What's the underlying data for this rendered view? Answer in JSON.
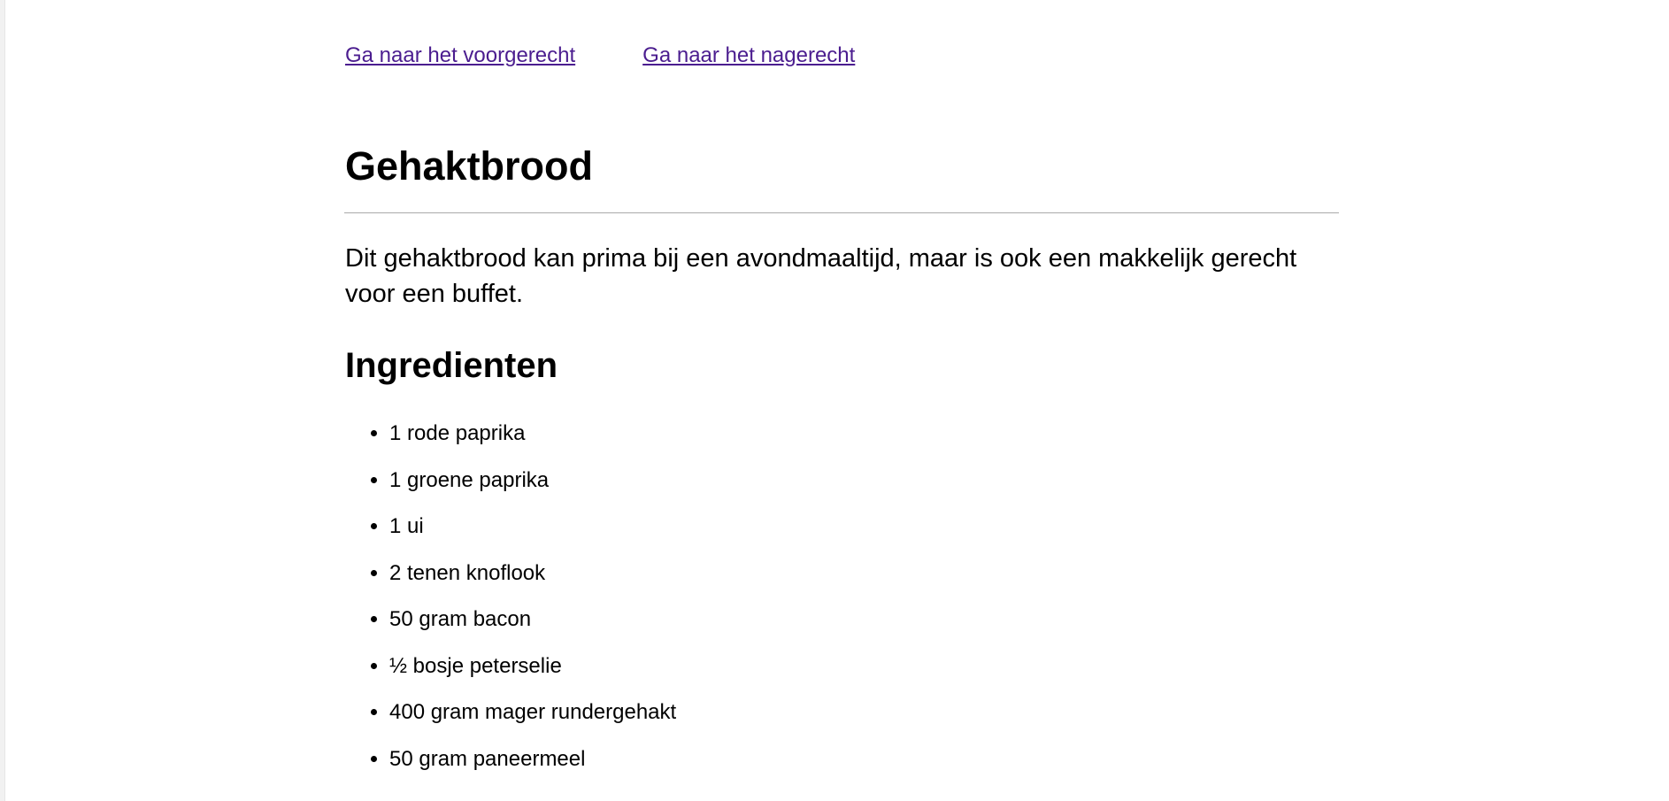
{
  "nav": {
    "starter_link": "Ga naar het voorgerecht",
    "dessert_link": "Ga naar het nagerecht"
  },
  "recipe": {
    "title": "Gehaktbrood",
    "intro": "Dit gehaktbrood kan prima bij een avondmaaltijd, maar is ook een makkelijk gerecht voor een buffet.",
    "ingredients_heading": "Ingredienten",
    "ingredients": [
      "1 rode paprika",
      "1 groene paprika",
      "1 ui",
      "2 tenen knoflook",
      "50 gram bacon",
      "½ bosje peterselie",
      "400 gram mager rundergehakt",
      "50 gram paneermeel"
    ]
  },
  "colors": {
    "link": "#4b1d8f",
    "rule": "#a9a9a9",
    "text": "#000000"
  }
}
